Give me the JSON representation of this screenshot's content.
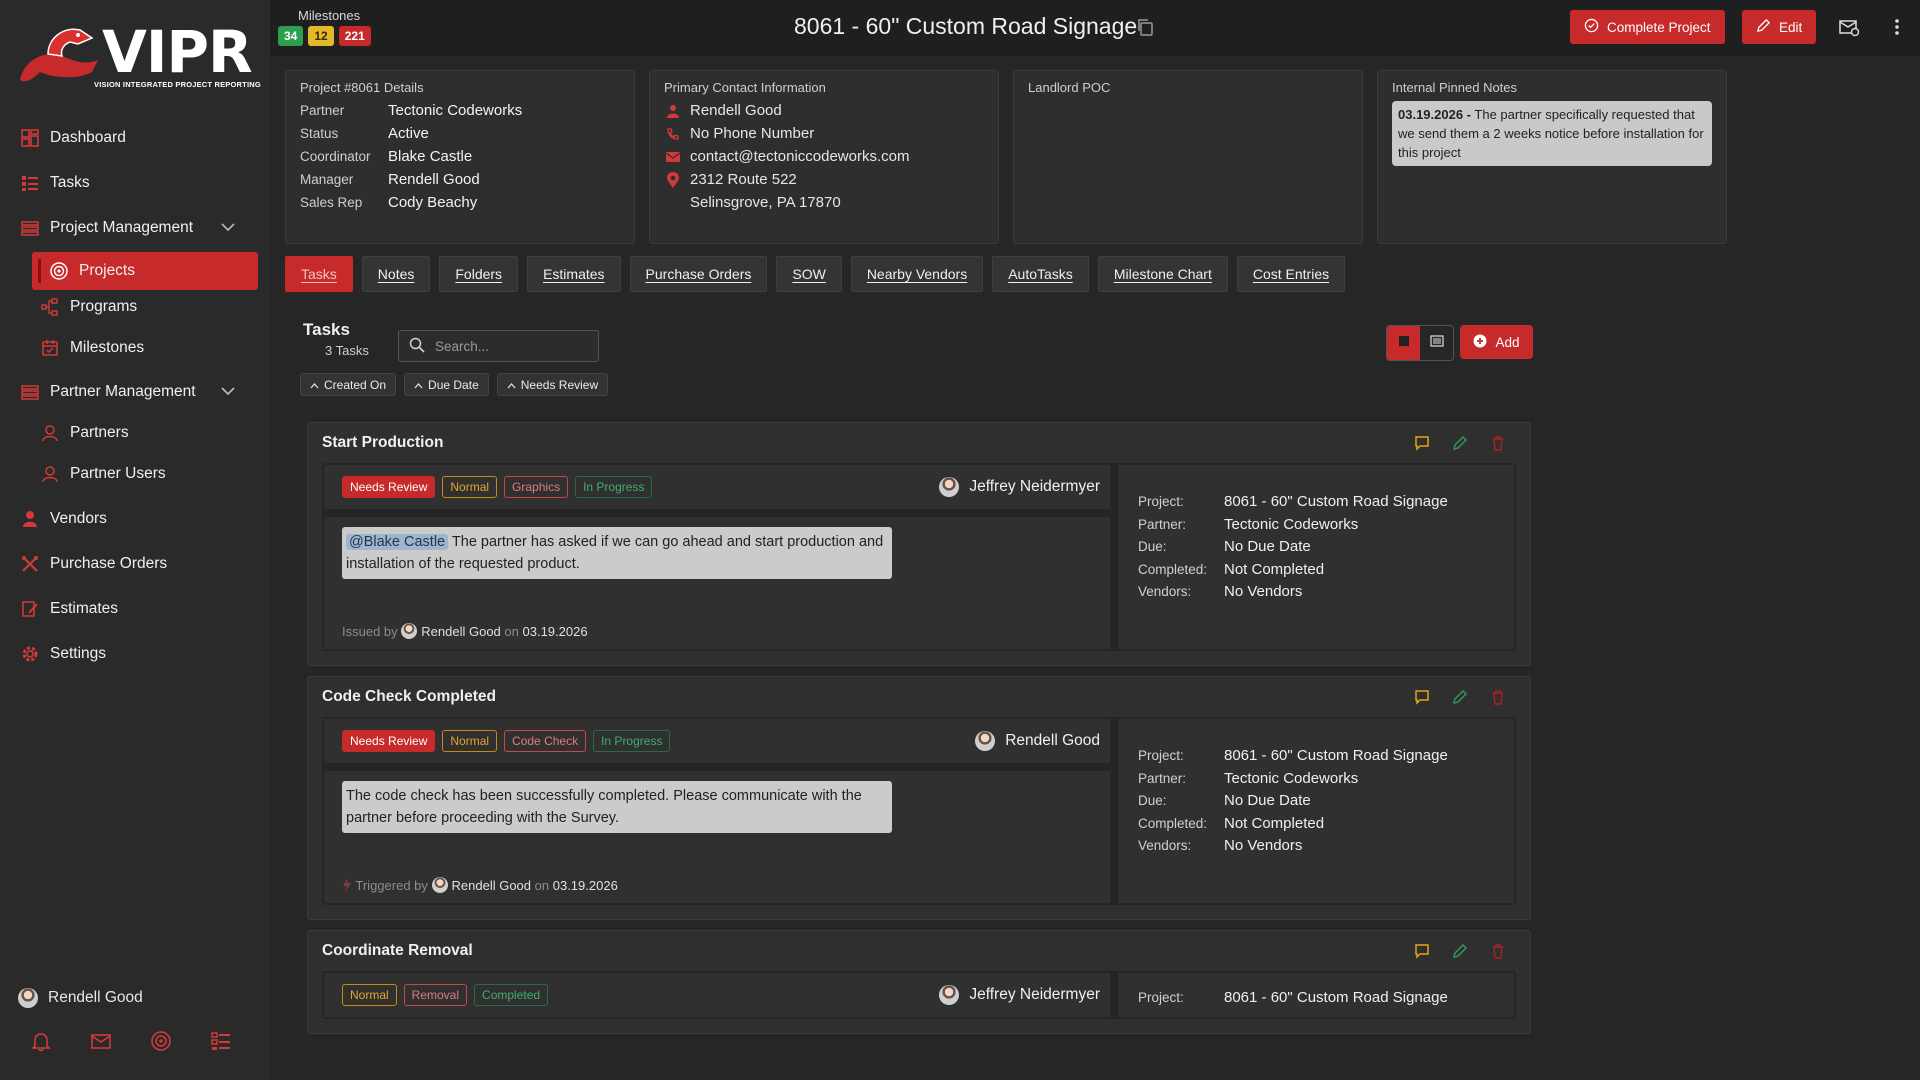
{
  "brand": {
    "name": "VIPR",
    "tagline": "VISION INTEGRATED PROJECT REPORTING"
  },
  "sidebar": {
    "items": [
      {
        "label": "Dashboard",
        "icon": "dashboard-icon"
      },
      {
        "label": "Tasks",
        "icon": "tasks-icon"
      },
      {
        "label": "Project Management",
        "icon": "project-management-icon"
      },
      {
        "label": "Projects",
        "icon": "target-icon"
      },
      {
        "label": "Programs",
        "icon": "programs-icon"
      },
      {
        "label": "Milestones",
        "icon": "milestones-icon"
      },
      {
        "label": "Partner Management",
        "icon": "partner-management-icon"
      },
      {
        "label": "Partners",
        "icon": "partners-icon"
      },
      {
        "label": "Partner Users",
        "icon": "partner-users-icon"
      },
      {
        "label": "Vendors",
        "icon": "vendors-icon"
      },
      {
        "label": "Purchase Orders",
        "icon": "purchase-orders-icon"
      },
      {
        "label": "Estimates",
        "icon": "estimates-icon"
      },
      {
        "label": "Settings",
        "icon": "settings-icon"
      }
    ],
    "user": "Rendell Good",
    "footer_icons": [
      "bell-icon",
      "mail-icon",
      "target-icon",
      "checklist-icon"
    ]
  },
  "header": {
    "milestones_label": "Milestones",
    "milestones": [
      {
        "count": "34",
        "color": "#2e9e4f"
      },
      {
        "count": "12",
        "color": "#e5b72a"
      },
      {
        "count": "221",
        "color": "#c62a2a"
      }
    ],
    "title": "8061 - 60\" Custom Road Signage",
    "complete_label": "Complete Project",
    "edit_label": "Edit"
  },
  "details": {
    "title": "Project #8061 Details",
    "rows": [
      {
        "k": "Partner",
        "v": "Tectonic Codeworks"
      },
      {
        "k": "Status",
        "v": "Active"
      },
      {
        "k": "Coordinator",
        "v": "Blake Castle"
      },
      {
        "k": "Manager",
        "v": "Rendell Good"
      },
      {
        "k": "Sales Rep",
        "v": "Cody Beachy"
      }
    ]
  },
  "contact": {
    "title": "Primary Contact Information",
    "name": "Rendell Good",
    "phone": "No Phone Number",
    "email": "contact@tectoniccodeworks.com",
    "address1": "2312 Route 522",
    "address2": "Selinsgrove, PA 17870"
  },
  "landlord": {
    "title": "Landlord POC"
  },
  "pinned": {
    "title": "Internal Pinned Notes",
    "date": "03.19.2026 -",
    "text": "The partner specifically requested that we send them a 2 weeks notice before installation for this project"
  },
  "tabs": [
    "Tasks",
    "Notes",
    "Folders",
    "Estimates",
    "Purchase Orders",
    "SOW",
    "Nearby Vendors",
    "AutoTasks",
    "Milestone Chart",
    "Cost Entries"
  ],
  "tasks_panel": {
    "title": "Tasks",
    "count": "3 Tasks",
    "search_placeholder": "Search...",
    "sorts": [
      "Created On",
      "Due Date",
      "Needs Review"
    ],
    "add_label": "Add"
  },
  "detail_labels": {
    "project": "Project:",
    "partner": "Partner:",
    "due": "Due:",
    "completed": "Completed:",
    "vendors": "Vendors:"
  },
  "tasks": [
    {
      "title": "Start Production",
      "tags": [
        {
          "label": "Needs Review",
          "kind": "nr"
        },
        {
          "label": "Normal",
          "kind": "normal"
        },
        {
          "label": "Graphics",
          "kind": "cat"
        },
        {
          "label": "In Progress",
          "kind": "prog"
        }
      ],
      "assignee": "Jeffrey Neidermyer",
      "mention": "@Blake Castle",
      "message": "The partner has asked if we can go ahead and start production and installation of the requested product.",
      "issued_prefix": "Issued by",
      "issued_by": "Rendell Good",
      "on": "on",
      "issued_date": "03.19.2026",
      "project": "8061 - 60\" Custom Road Signage",
      "partner": "Tectonic Codeworks",
      "due": "No Due Date",
      "completed": "Not Completed",
      "vendors": "No Vendors"
    },
    {
      "title": "Code Check Completed",
      "tags": [
        {
          "label": "Needs Review",
          "kind": "nr"
        },
        {
          "label": "Normal",
          "kind": "normal"
        },
        {
          "label": "Code Check",
          "kind": "cat"
        },
        {
          "label": "In Progress",
          "kind": "prog"
        }
      ],
      "assignee": "Rendell Good",
      "mention": "",
      "message": "The code check has been successfully completed. Please communicate with the partner before proceeding with the Survey.",
      "issued_prefix": "Triggered by",
      "issued_by": "Rendell Good",
      "on": "on",
      "issued_date": "03.19.2026",
      "project": "8061 - 60\" Custom Road Signage",
      "partner": "Tectonic Codeworks",
      "due": "No Due Date",
      "completed": "Not Completed",
      "vendors": "No Vendors"
    },
    {
      "title": "Coordinate Removal",
      "tags": [
        {
          "label": "Normal",
          "kind": "normal"
        },
        {
          "label": "Removal",
          "kind": "cat"
        },
        {
          "label": "Completed",
          "kind": "prog"
        }
      ],
      "assignee": "Jeffrey Neidermyer",
      "project": "8061 - 60\" Custom Road Signage"
    }
  ]
}
